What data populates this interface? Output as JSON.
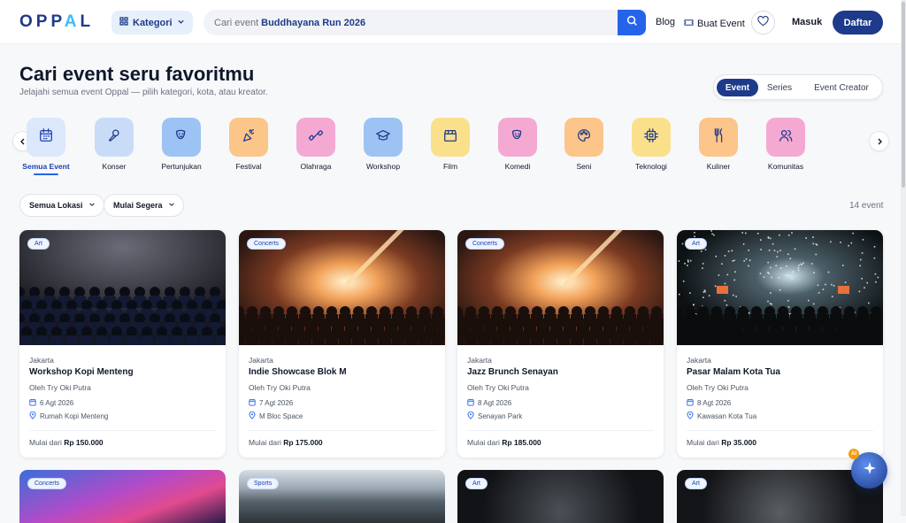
{
  "header": {
    "logo": "OPPAL",
    "kategori": "Kategori",
    "search_prefix": "Cari event",
    "search_query": "Buddhayana Run 2026",
    "blog": "Blog",
    "buat_event": "Buat Event",
    "masuk": "Masuk",
    "daftar": "Daftar"
  },
  "page": {
    "title": "Cari event seru favoritmu",
    "subtitle": "Jelajahi semua event Oppal — pilih kategori, kota, atau kreator.",
    "tabs": [
      "Event",
      "Series",
      "Event Creator"
    ],
    "active_tab": "Event"
  },
  "categories": [
    {
      "label": "Semua Event",
      "icon": "calendar-icon",
      "color": "#dbe7fb"
    },
    {
      "label": "Konser",
      "icon": "microphone-icon",
      "color": "#c8dcf8"
    },
    {
      "label": "Pertunjukan",
      "icon": "theater-mask-icon",
      "color": "#9cc3f3"
    },
    {
      "label": "Festival",
      "icon": "party-popper-icon",
      "color": "#fcc58a"
    },
    {
      "label": "Olahraga",
      "icon": "dumbbell-icon",
      "color": "#f4a9d3"
    },
    {
      "label": "Workshop",
      "icon": "graduation-cap-icon",
      "color": "#9cc3f3"
    },
    {
      "label": "Film",
      "icon": "clapperboard-icon",
      "color": "#fbe08c"
    },
    {
      "label": "Komedi",
      "icon": "comedy-mask-icon",
      "color": "#f4a9d3"
    },
    {
      "label": "Seni",
      "icon": "palette-icon",
      "color": "#fcc58a"
    },
    {
      "label": "Teknologi",
      "icon": "chip-icon",
      "color": "#fbe08c"
    },
    {
      "label": "Kuliner",
      "icon": "utensils-icon",
      "color": "#fcc58a"
    },
    {
      "label": "Komunitas",
      "icon": "users-icon",
      "color": "#f4a9d3"
    }
  ],
  "filters": {
    "lokasi": "Semua Lokasi",
    "urutan": "Mulai Segera",
    "count": "14 event"
  },
  "events": [
    {
      "badge": "Art",
      "city": "Jakarta",
      "name": "Workshop Kopi Menteng",
      "organizer": "Oleh Try Oki Putra",
      "date": "6 Agt 2026",
      "venue": "Rumah Kopi Menteng",
      "price_prefix": "Mulai dari",
      "price": "Rp 150.000"
    },
    {
      "badge": "Concerts",
      "city": "Jakarta",
      "name": "Indie Showcase Blok M",
      "organizer": "Oleh Try Oki Putra",
      "date": "7 Agt 2026",
      "venue": "M Bloc Space",
      "price_prefix": "Mulai dari",
      "price": "Rp 175.000"
    },
    {
      "badge": "Concerts",
      "city": "Jakarta",
      "name": "Jazz Brunch Senayan",
      "organizer": "Oleh Try Oki Putra",
      "date": "8 Agt 2026",
      "venue": "Senayan Park",
      "price_prefix": "Mulai dari",
      "price": "Rp 185.000"
    },
    {
      "badge": "Art",
      "city": "Jakarta",
      "name": "Pasar Malam Kota Tua",
      "organizer": "Oleh Try Oki Putra",
      "date": "8 Agt 2026",
      "venue": "Kawasan Kota Tua",
      "price_prefix": "Mulai dari",
      "price": "Rp 35.000"
    }
  ],
  "next_row_badges": [
    "Concerts",
    "Sports",
    "Art",
    "Art"
  ],
  "assistant": {
    "badge": "AI"
  }
}
